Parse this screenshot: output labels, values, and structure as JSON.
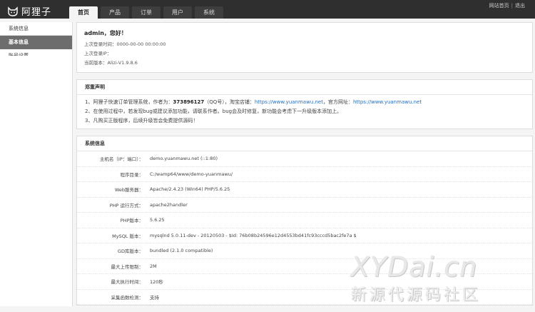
{
  "app": {
    "name": "阿狸子"
  },
  "nav": [
    {
      "label": "首页",
      "active": true
    },
    {
      "label": "产品",
      "active": false
    },
    {
      "label": "订单",
      "active": false
    },
    {
      "label": "用户",
      "active": false
    },
    {
      "label": "系统",
      "active": false
    }
  ],
  "toplinks": {
    "home": "网站首页",
    "sep": "|",
    "logout": "退出"
  },
  "sidebar": {
    "heading": "系统信息",
    "items": [
      {
        "label": "基本信息",
        "active": true
      },
      {
        "label": "账号设置",
        "active": false
      }
    ]
  },
  "welcome": {
    "hello": "admin，您好！",
    "last_time_label": "上次登录时间：",
    "last_time": "0000-00-00 00:00:00",
    "last_ip_label": "上次登录IP：",
    "last_ip": "",
    "version_label": "当前版本：",
    "version": "Alizi-V1.9.8.6"
  },
  "notice": {
    "title": "郑重声明",
    "line1_pre": "1、阿狸子快速订单管理系统，作者为：",
    "line1_qq": "373896127",
    "line1_qq_suffix": "（QQ号），淘宝店铺：",
    "line1_shop": "https://www.yuanmawu.net",
    "line1_site_label": "，官方网址：",
    "line1_site": "https://www.yuanmawu.net",
    "line2": "2、在使用过程中，若发现bug或建议添加功能，请联系作者。bug会及时修复，新功能会考虑下一升级版本添加上。",
    "line3": "3、凡购买正版程序，后续升级皆会免费提供源码！"
  },
  "sysinfo": {
    "title": "系统信息",
    "rows": [
      {
        "key": "主机名（IP：端口）：",
        "value": "demo.yuanmawu.net (::1:80)"
      },
      {
        "key": "程序目录：",
        "value": "C:/wamp64/www/demo-yuanmawu/"
      },
      {
        "key": "Web服务器：",
        "value": "Apache/2.4.23 (Win64) PHP/5.6.25"
      },
      {
        "key": "PHP 运行方式：",
        "value": "apache2handler"
      },
      {
        "key": "PHP版本：",
        "value": "5.6.25"
      },
      {
        "key": "MySQL 版本：",
        "value": "mysqlnd 5.0.11-dev - 20120503 - $Id: 76b08b24596e12d4553bd41fc93cccd5bac2fe7a $"
      },
      {
        "key": "GD库版本：",
        "value": "bundled (2.1.0 compatible)"
      },
      {
        "key": "最大上传限制：",
        "value": "2M"
      },
      {
        "key": "最大执行时间：",
        "value": "120秒"
      },
      {
        "key": "采集函数检测：",
        "value": "支持"
      }
    ]
  },
  "watermark": {
    "line1": "XYDai.cn",
    "line2": "新源代源码社区"
  },
  "icons": {
    "logo": "fox-logo-icon"
  },
  "colors": {
    "topbar": "#2f2f2f",
    "sidebar_active": "#6d6d6d",
    "link": "#2a6ebb"
  }
}
